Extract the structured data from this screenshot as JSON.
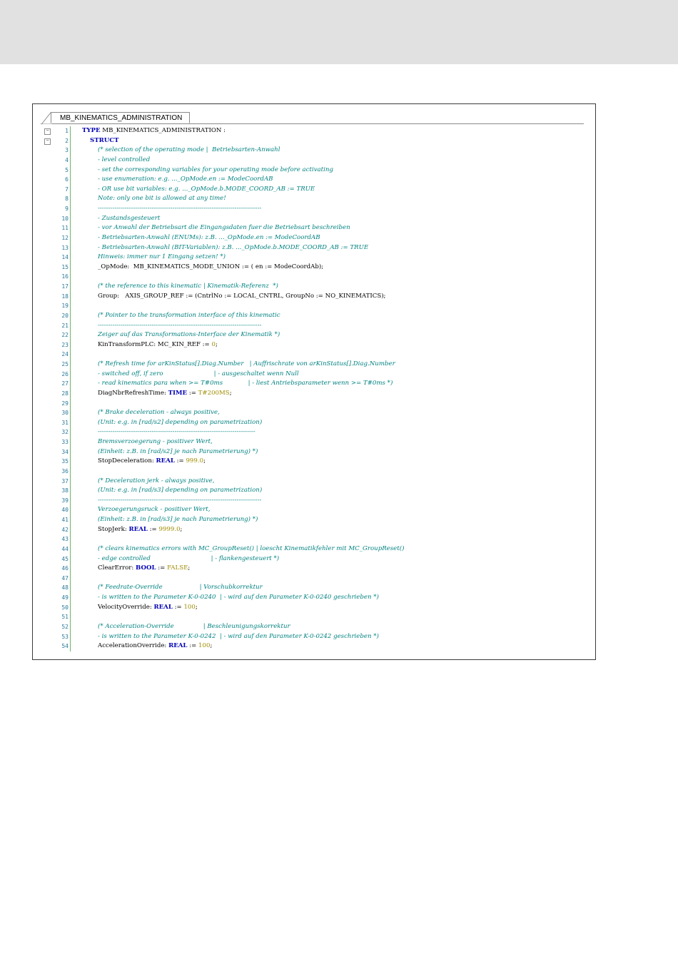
{
  "editor": {
    "tab_label": "MB_KINEMATICS_ADMINISTRATION",
    "lines": [
      {
        "n": "1",
        "fold": true,
        "segs": [
          [
            "k",
            "TYPE"
          ],
          [
            "p",
            " MB_KINEMATICS_ADMINISTRATION :"
          ]
        ]
      },
      {
        "n": "2",
        "fold": true,
        "segs": [
          [
            "k",
            "STRUCT"
          ]
        ]
      },
      {
        "n": "3",
        "segs": [
          [
            "c",
            "(* selection of the operating mode |  Betriebsarten-Anwahl"
          ]
        ]
      },
      {
        "n": "4",
        "segs": [
          [
            "c",
            "- level controlled"
          ]
        ]
      },
      {
        "n": "5",
        "segs": [
          [
            "c",
            "- set the corresponding variables for your operating mode before activating"
          ]
        ]
      },
      {
        "n": "6",
        "segs": [
          [
            "c",
            "- use enumeration: e.g. ..._OpMode.en := ModeCoordAB"
          ]
        ]
      },
      {
        "n": "7",
        "segs": [
          [
            "c",
            "- OR use bit variables: e.g. ..._OpMode.b.MODE_COORD_AB := TRUE"
          ]
        ]
      },
      {
        "n": "8",
        "segs": [
          [
            "c",
            "Note: only one bit is allowed at any time!"
          ]
        ]
      },
      {
        "n": "9",
        "segs": [
          [
            "c",
            "-------------------------------------------------------------------------------"
          ]
        ]
      },
      {
        "n": "10",
        "segs": [
          [
            "c",
            "- Zustandsgesteuert"
          ]
        ]
      },
      {
        "n": "11",
        "segs": [
          [
            "c",
            "- vor Anwahl der Betriebsart die Eingangsdaten fuer die Betriebsart beschreiben"
          ]
        ]
      },
      {
        "n": "12",
        "segs": [
          [
            "c",
            "- Betriebsarten-Anwahl (ENUMs): z.B. ..._OpMode.en := ModeCoordAB"
          ]
        ]
      },
      {
        "n": "13",
        "segs": [
          [
            "c",
            "- Betriebsarten-Anwahl (BIT-Variablen): z.B. ..._OpMode.b.MODE_COORD_AB := TRUE"
          ]
        ]
      },
      {
        "n": "14",
        "segs": [
          [
            "c",
            "Hinweis: immer nur 1 Eingang setzen! *)"
          ]
        ]
      },
      {
        "n": "15",
        "segs": [
          [
            "p",
            "_OpMode:  MB_KINEMATICS_MODE_UNION := ( en := ModeCoordAb);"
          ]
        ]
      },
      {
        "n": "16",
        "segs": []
      },
      {
        "n": "17",
        "segs": [
          [
            "c",
            "(* the reference to this kinematic | Kinematik-Referenz  *)"
          ]
        ]
      },
      {
        "n": "18",
        "segs": [
          [
            "p",
            "Group:   AXIS_GROUP_REF := (CntrlNo := LOCAL_CNTRL, GroupNo := NO_KINEMATICS);"
          ]
        ]
      },
      {
        "n": "19",
        "segs": []
      },
      {
        "n": "20",
        "segs": [
          [
            "c",
            "(* Pointer to the transformation interface of this kinematic"
          ]
        ]
      },
      {
        "n": "21",
        "segs": [
          [
            "c",
            "-------------------------------------------------------------------------------"
          ]
        ]
      },
      {
        "n": "22",
        "segs": [
          [
            "c",
            "Zeiger auf das Transformations-Interface der Kinematik *)"
          ]
        ]
      },
      {
        "n": "23",
        "segs": [
          [
            "p",
            "KinTransformPLC: MC_KIN_REF := "
          ],
          [
            "n",
            "0"
          ],
          [
            "p",
            ";"
          ]
        ]
      },
      {
        "n": "24",
        "segs": []
      },
      {
        "n": "25",
        "segs": [
          [
            "c",
            "(* Refresh time for arKinStatus[].Diag.Number   | Auffrischrate von arKinStatus[].Diag.Number"
          ]
        ]
      },
      {
        "n": "26",
        "segs": [
          [
            "c",
            "- switched off, if zero                          | - ausgeschaltet wenn Null"
          ]
        ]
      },
      {
        "n": "27",
        "segs": [
          [
            "c",
            "- read kinematics para when >= T#0ms             | - liest Antriebsparameter wenn >= T#0ms *)"
          ]
        ]
      },
      {
        "n": "28",
        "segs": [
          [
            "p",
            "DiagNbrRefreshTime: "
          ],
          [
            "k",
            "TIME"
          ],
          [
            "p",
            " := "
          ],
          [
            "n",
            "T#200MS"
          ],
          [
            "p",
            ";"
          ]
        ]
      },
      {
        "n": "29",
        "segs": []
      },
      {
        "n": "30",
        "segs": [
          [
            "c",
            "(* Brake deceleration - always positive,"
          ]
        ]
      },
      {
        "n": "31",
        "segs": [
          [
            "c",
            "(Unit: e.g. in [rad/s2] depending on parametrization)"
          ]
        ]
      },
      {
        "n": "32",
        "segs": [
          [
            "c",
            "----------------------------------------------------------------------------"
          ]
        ]
      },
      {
        "n": "33",
        "segs": [
          [
            "c",
            "Bremsverzoegerung - positiver Wert,"
          ]
        ]
      },
      {
        "n": "34",
        "segs": [
          [
            "c",
            "(Einheit: z.B. in [rad/s2] je nach Parametrierung) *)"
          ]
        ]
      },
      {
        "n": "35",
        "segs": [
          [
            "p",
            "StopDeceleration: "
          ],
          [
            "k",
            "REAL"
          ],
          [
            "p",
            " := "
          ],
          [
            "n",
            "999.0"
          ],
          [
            "p",
            ";"
          ]
        ]
      },
      {
        "n": "36",
        "segs": []
      },
      {
        "n": "37",
        "segs": [
          [
            "c",
            "(* Deceleration jerk - always positive,"
          ]
        ]
      },
      {
        "n": "38",
        "segs": [
          [
            "c",
            "(Unit: e.g. in [rad/s3] depending on parametrization)"
          ]
        ]
      },
      {
        "n": "39",
        "segs": [
          [
            "c",
            "-------------------------------------------------------------------------------"
          ]
        ]
      },
      {
        "n": "40",
        "segs": [
          [
            "c",
            "Verzoegerungsruck - positiver Wert,"
          ]
        ]
      },
      {
        "n": "41",
        "segs": [
          [
            "c",
            "(Einheit: z.B. in [rad/s3] je nach Parametrierung) *)"
          ]
        ]
      },
      {
        "n": "42",
        "segs": [
          [
            "p",
            "StopJerk: "
          ],
          [
            "k",
            "REAL"
          ],
          [
            "p",
            " := "
          ],
          [
            "n",
            "9999.0"
          ],
          [
            "p",
            ";"
          ]
        ]
      },
      {
        "n": "43",
        "segs": []
      },
      {
        "n": "44",
        "segs": [
          [
            "c",
            "(* clears kinematics errors with MC_GroupReset() | loescht Kinematikfehler mit MC_GroupReset()"
          ]
        ]
      },
      {
        "n": "45",
        "segs": [
          [
            "c",
            "- edge controlled                               | - flankengesteuert *)"
          ]
        ]
      },
      {
        "n": "46",
        "segs": [
          [
            "p",
            "ClearError: "
          ],
          [
            "k",
            "BOOL"
          ],
          [
            "p",
            " := "
          ],
          [
            "n",
            "FALSE"
          ],
          [
            "p",
            ";"
          ]
        ]
      },
      {
        "n": "47",
        "segs": []
      },
      {
        "n": "48",
        "segs": [
          [
            "c",
            "(* Feedrate-Override                   | Vorschubkorrektur"
          ]
        ]
      },
      {
        "n": "49",
        "segs": [
          [
            "c",
            "- is written to the Parameter K-0-0240  | - wird auf den Parameter K-0-0240 geschrieben *)"
          ]
        ]
      },
      {
        "n": "50",
        "segs": [
          [
            "p",
            "VelocityOverride: "
          ],
          [
            "k",
            "REAL"
          ],
          [
            "p",
            " := "
          ],
          [
            "n",
            "100"
          ],
          [
            "p",
            ";"
          ]
        ]
      },
      {
        "n": "51",
        "segs": []
      },
      {
        "n": "52",
        "segs": [
          [
            "c",
            "(* Acceleration-Override               | Beschleunigungskorrektur"
          ]
        ]
      },
      {
        "n": "53",
        "segs": [
          [
            "c",
            "- is written to the Parameter K-0-0242  | - wird auf den Parameter K-0-0242 geschrieben *)"
          ]
        ]
      },
      {
        "n": "54",
        "segs": [
          [
            "p",
            "AccelerationOverride: "
          ],
          [
            "k",
            "REAL"
          ],
          [
            "p",
            " := "
          ],
          [
            "n",
            "100"
          ],
          [
            "p",
            ";"
          ]
        ]
      }
    ]
  }
}
